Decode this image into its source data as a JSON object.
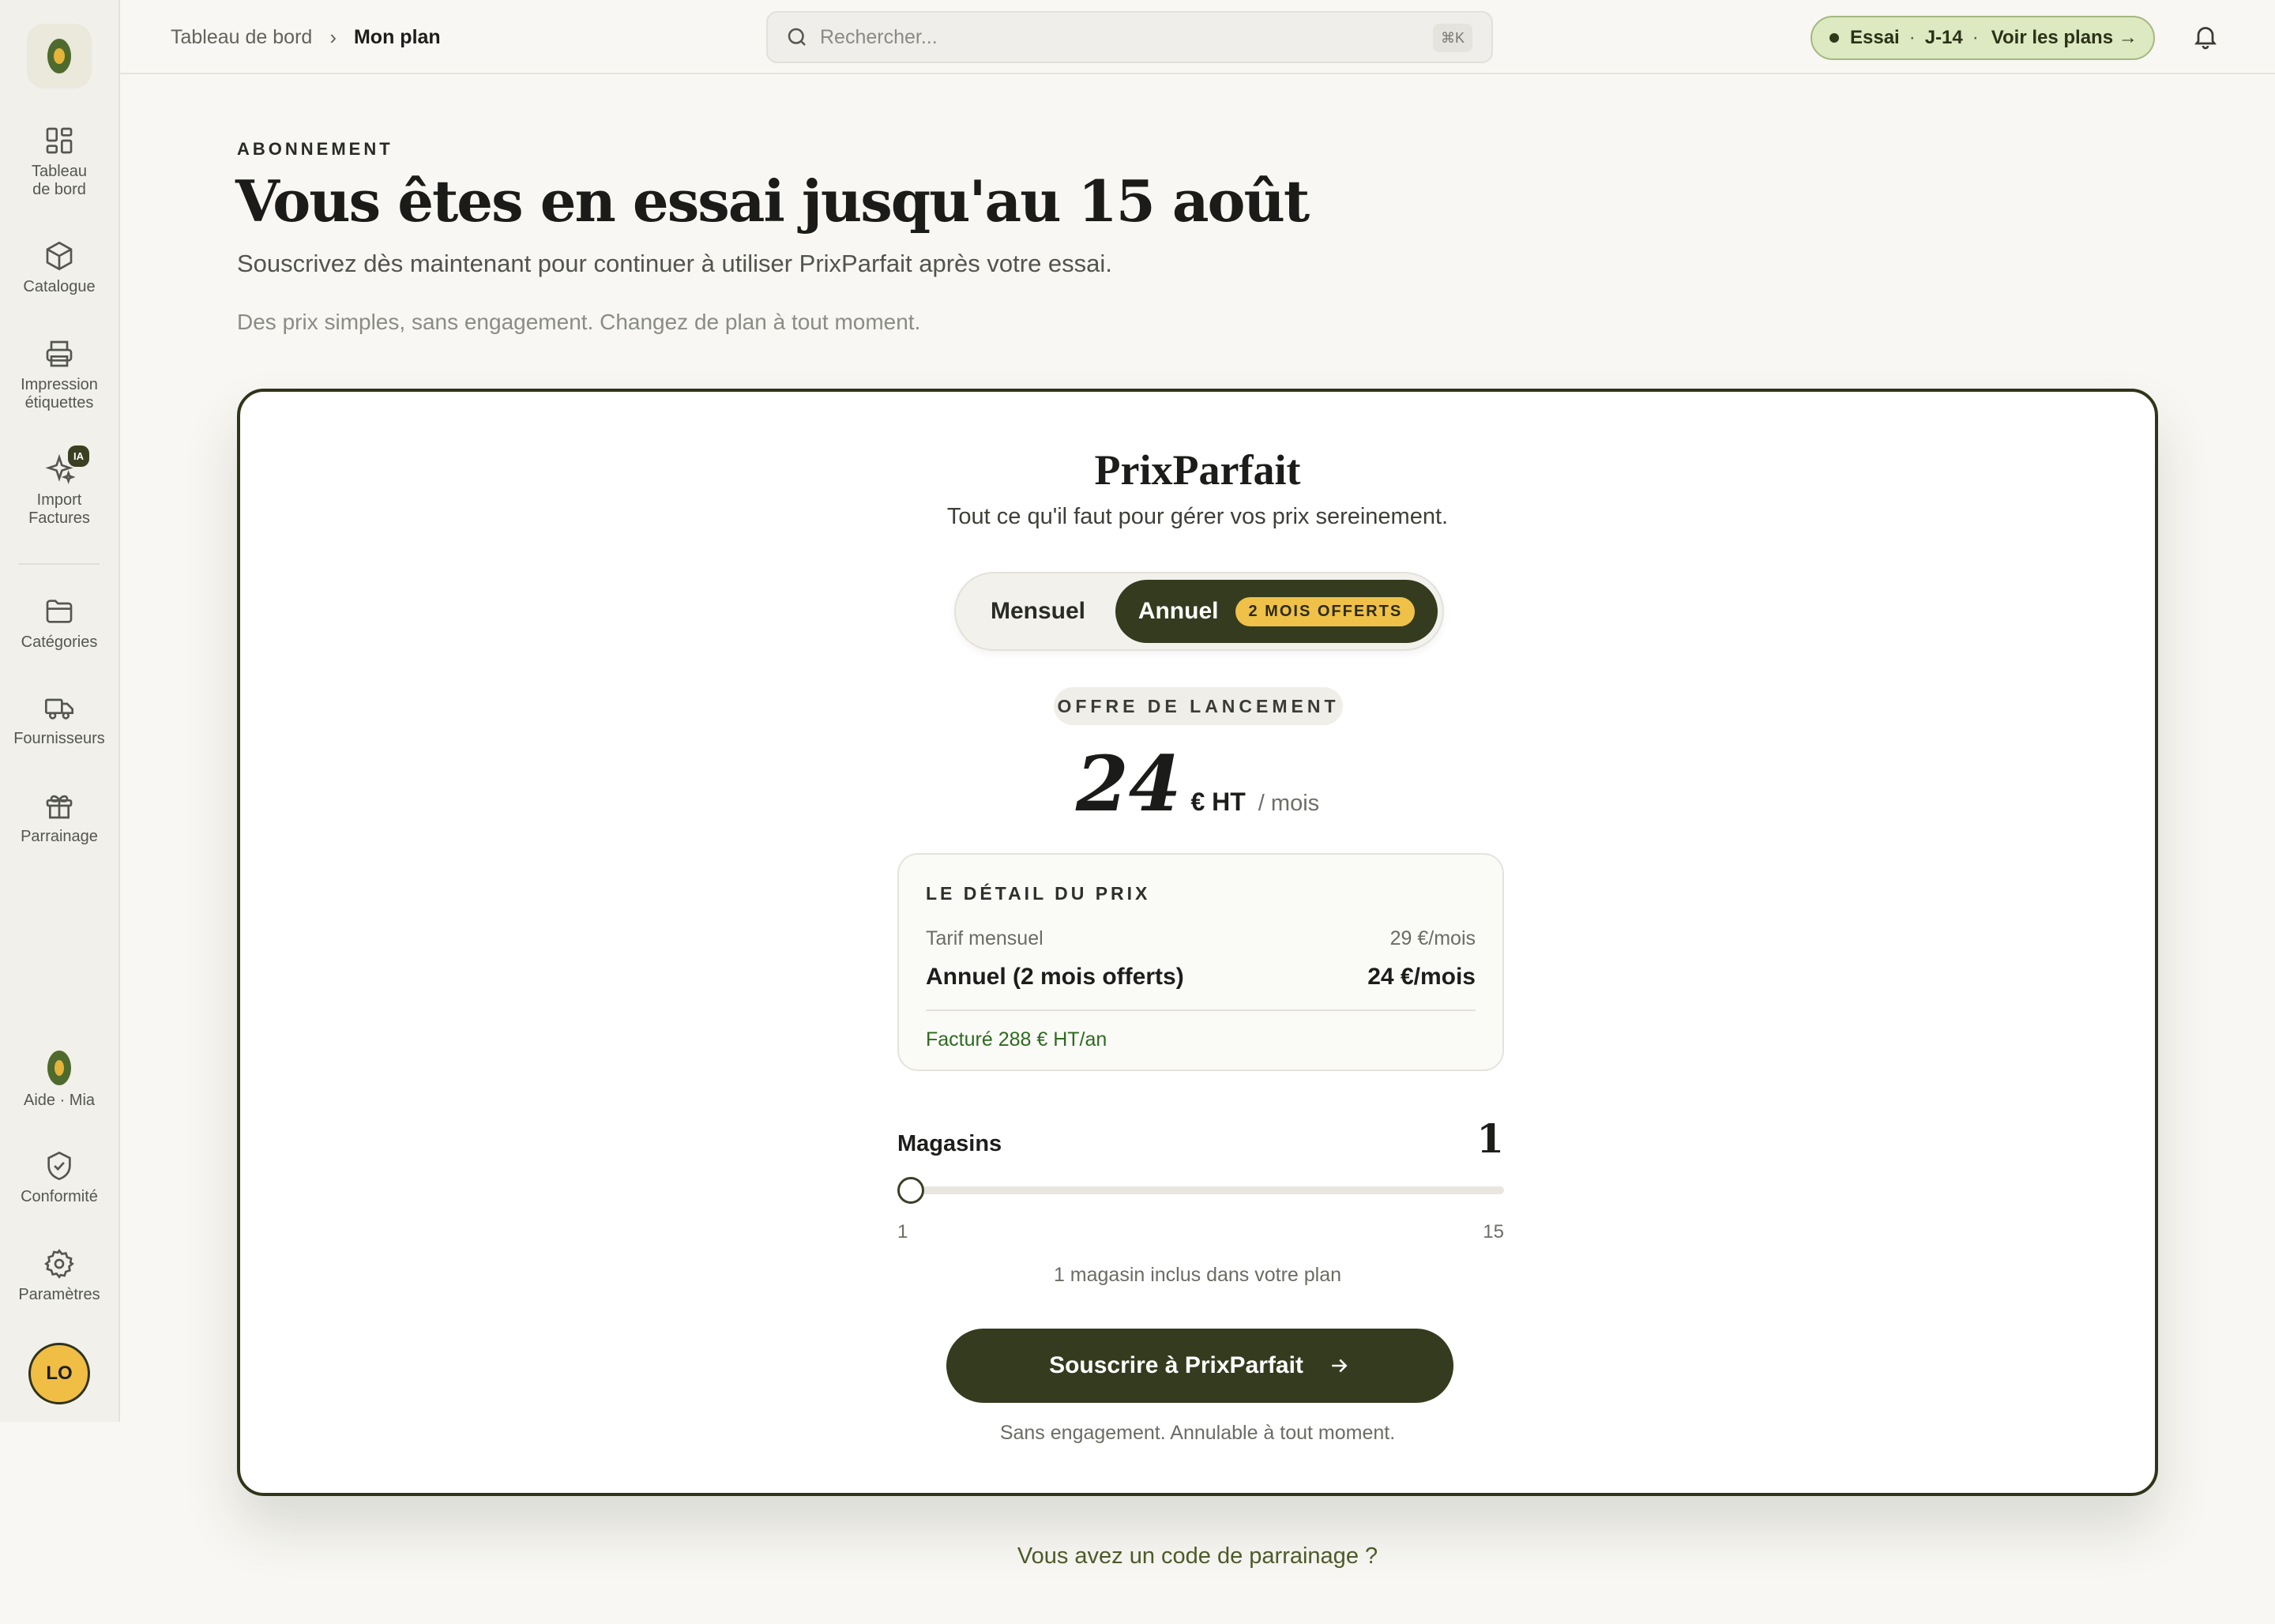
{
  "sidebar": {
    "items": [
      {
        "label1": "Tableau",
        "label2": "de bord"
      },
      {
        "label1": "Catalogue",
        "label2": ""
      },
      {
        "label1": "Impression",
        "label2": "étiquettes"
      },
      {
        "label1": "Import",
        "label2": "Factures",
        "badge": "IA"
      },
      {
        "label1": "Catégories",
        "label2": ""
      },
      {
        "label1": "Fournisseurs",
        "label2": ""
      },
      {
        "label1": "Parrainage",
        "label2": ""
      }
    ],
    "bottom": {
      "help": "Aide · Mia",
      "compliance": "Conformité",
      "settings": "Paramètres",
      "user_initials": "LO"
    }
  },
  "topbar": {
    "breadcrumb": [
      "Tableau de bord",
      "Mon plan"
    ],
    "breadcrumb_sep": "›",
    "search_placeholder": "Rechercher...",
    "search_shortcut": "⌘K",
    "trial": {
      "label": "Essai",
      "sep": "·",
      "days": "J-14",
      "sep2": "·",
      "link": "Voir les plans →"
    }
  },
  "header": {
    "eyebrow": "ABONNEMENT",
    "title": "Vous êtes en essai jusqu'au 15 août",
    "subtitle": "Souscrivez dès maintenant pour continuer à utiliser PrixParfait après votre essai.",
    "note": "Des prix simples, sans engagement. Changez de plan à tout moment."
  },
  "plan": {
    "name": "PrixParfait",
    "tagline": "Tout ce qu'il faut pour gérer vos prix sereinement.",
    "billing_toggle": {
      "monthly": "Mensuel",
      "annual": "Annuel",
      "annual_badge": "2 MOIS OFFERTS",
      "selected": "annual"
    },
    "launch_badge": "OFFRE DE LANCEMENT",
    "price": {
      "amount": "24",
      "currency": "€ HT",
      "period": "/ mois"
    },
    "detail": {
      "title": "LE DÉTAIL DU PRIX",
      "row1_label": "Tarif mensuel",
      "row1_value": "29 €/mois",
      "row2_label": "Annuel (2 mois offerts)",
      "row2_value": "24 €/mois",
      "billed": "Facturé 288 € HT/an"
    },
    "stores": {
      "label": "Magasins",
      "value": "1",
      "min": "1",
      "max": "15",
      "note": "1 magasin inclus dans votre plan"
    },
    "cta": "Souscrire à PrixParfait",
    "disclaimer": "Sans engagement. Annulable à tout moment."
  },
  "referral_link": "Vous avez un code de parrainage ?",
  "colors": {
    "brand_dark": "#343b1e",
    "accent_yellow": "#efc149",
    "trial_green": "#dde9c1",
    "background": "#f8f7f3"
  }
}
